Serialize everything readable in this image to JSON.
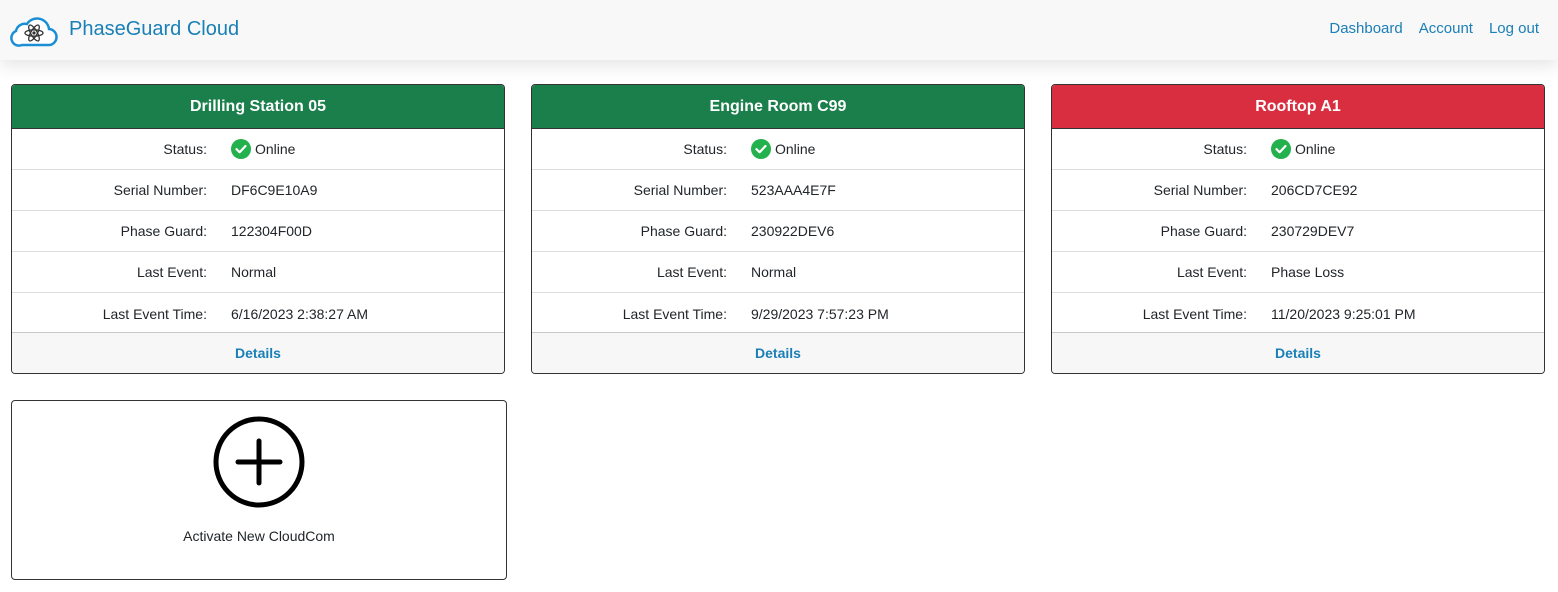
{
  "app": {
    "brand": "PhaseGuard Cloud",
    "brand_color": "#1a7fb6",
    "logo_icon": "cloud-atom-icon"
  },
  "nav": {
    "links": [
      "Dashboard",
      "Account",
      "Log out"
    ]
  },
  "labels": {
    "status": "Status:",
    "serial": "Serial Number:",
    "phase_guard": "Phase Guard:",
    "last_event": "Last Event:",
    "last_event_time": "Last Event Time:",
    "details": "Details"
  },
  "devices": [
    {
      "name": "Drilling Station 05",
      "header_color": "#1b7f4c",
      "status": "Online",
      "status_icon": "check-circle-icon",
      "serial": "DF6C9E10A9",
      "phase_guard": "122304F00D",
      "last_event": "Normal",
      "last_event_time": "6/16/2023 2:38:27 AM"
    },
    {
      "name": "Engine Room C99",
      "header_color": "#1b7f4c",
      "status": "Online",
      "status_icon": "check-circle-icon",
      "serial": "523AAA4E7F",
      "phase_guard": "230922DEV6",
      "last_event": "Normal",
      "last_event_time": "9/29/2023 7:57:23 PM"
    },
    {
      "name": "Rooftop A1",
      "header_color": "#d92e3f",
      "status": "Online",
      "status_icon": "check-circle-icon",
      "serial": "206CD7CE92",
      "phase_guard": "230729DEV7",
      "last_event": "Phase Loss",
      "last_event_time": "11/20/2023 9:25:01 PM"
    }
  ],
  "activate": {
    "label": "Activate New CloudCom",
    "icon": "plus-circle-icon"
  },
  "status_online_color": "#22b14c"
}
